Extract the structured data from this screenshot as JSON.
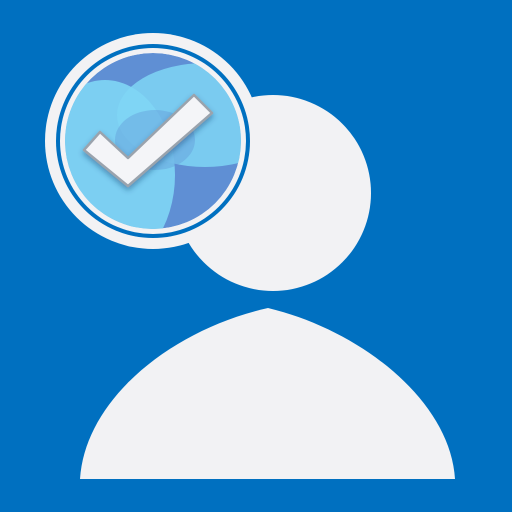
{
  "icon": {
    "name": "user-verified-icon",
    "colors": {
      "background": "#0070c0",
      "figure": "#f2f2f4",
      "badge_ring": "#f2f2f4",
      "badge_blue": "#5f8fd4",
      "badge_light": "#7fd6f5",
      "check_fill": "#f4f5f8",
      "check_outline": "#9aa3ad"
    }
  }
}
